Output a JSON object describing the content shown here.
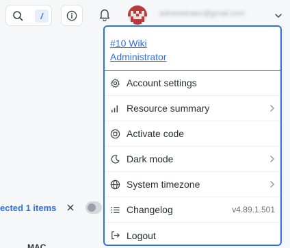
{
  "topbar": {
    "search_shortcut": "/",
    "user_email": "administrator@gmail.com"
  },
  "background": {
    "selected_text": "ected 1 items",
    "column_header": "MAC"
  },
  "menu": {
    "site_name": "#10 Wiki",
    "role": "Administrator",
    "items": [
      {
        "label": "Account settings",
        "icon": "gear-icon",
        "has_submenu": false
      },
      {
        "label": "Resource summary",
        "icon": "bar-chart-icon",
        "has_submenu": true
      },
      {
        "label": "Activate code",
        "icon": "code-icon",
        "has_submenu": false
      },
      {
        "label": "Dark mode",
        "icon": "moon-icon",
        "has_submenu": true
      },
      {
        "label": "System timezone",
        "icon": "globe-icon",
        "has_submenu": true
      },
      {
        "label": "Changelog",
        "icon": "list-icon",
        "has_submenu": false,
        "trailing": "v4.89.1.501"
      },
      {
        "label": "Logout",
        "icon": "logout-icon",
        "has_submenu": false
      }
    ]
  },
  "colors": {
    "accent": "#2f6fe4",
    "text": "#2a2e34",
    "muted": "#6b7078"
  }
}
